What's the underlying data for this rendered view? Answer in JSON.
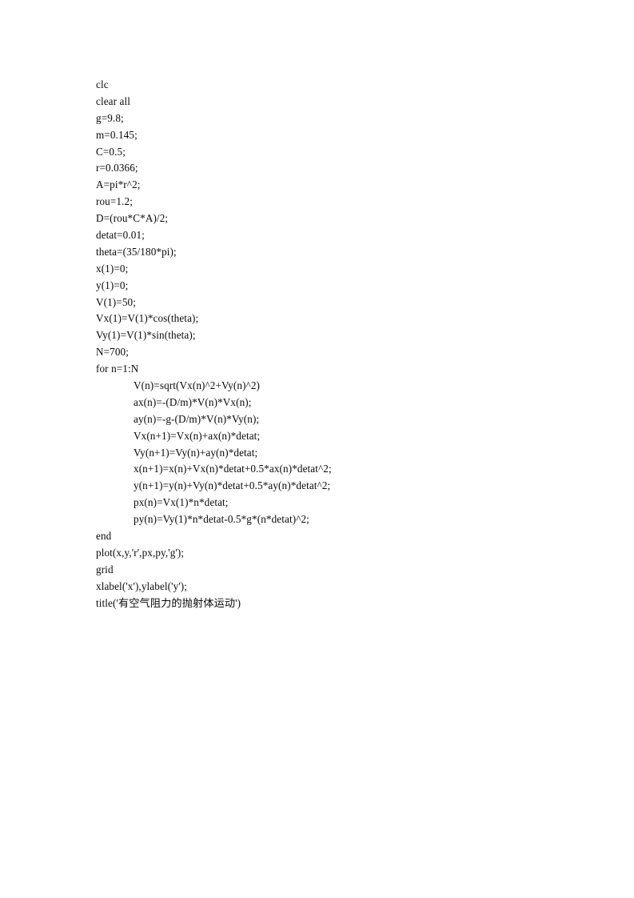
{
  "document": {
    "page_background": "#ffffff",
    "text_color": "#0a0a0a",
    "code": {
      "language": "MATLAB",
      "lines": [
        {
          "text": "clc",
          "indent": false
        },
        {
          "text": "clear all",
          "indent": false
        },
        {
          "text": "g=9.8;",
          "indent": false
        },
        {
          "text": "m=0.145;",
          "indent": false
        },
        {
          "text": "C=0.5;",
          "indent": false
        },
        {
          "text": "r=0.0366;",
          "indent": false
        },
        {
          "text": "A=pi*r^2;",
          "indent": false
        },
        {
          "text": "rou=1.2;",
          "indent": false
        },
        {
          "text": "D=(rou*C*A)/2;",
          "indent": false
        },
        {
          "text": "detat=0.01;",
          "indent": false
        },
        {
          "text": "theta=(35/180*pi);",
          "indent": false
        },
        {
          "text": "x(1)=0;",
          "indent": false
        },
        {
          "text": "y(1)=0;",
          "indent": false
        },
        {
          "text": "V(1)=50;",
          "indent": false
        },
        {
          "text": "Vx(1)=V(1)*cos(theta);",
          "indent": false
        },
        {
          "text": "Vy(1)=V(1)*sin(theta);",
          "indent": false
        },
        {
          "text": "N=700;",
          "indent": false
        },
        {
          "text": "for n=1:N",
          "indent": false
        },
        {
          "text": "V(n)=sqrt(Vx(n)^2+Vy(n)^2)",
          "indent": true
        },
        {
          "text": "ax(n)=-(D/m)*V(n)*Vx(n);",
          "indent": true
        },
        {
          "text": "ay(n)=-g-(D/m)*V(n)*Vy(n);",
          "indent": true
        },
        {
          "text": "Vx(n+1)=Vx(n)+ax(n)*detat;",
          "indent": true
        },
        {
          "text": "Vy(n+1)=Vy(n)+ay(n)*detat;",
          "indent": true
        },
        {
          "text": "x(n+1)=x(n)+Vx(n)*detat+0.5*ax(n)*detat^2;",
          "indent": true
        },
        {
          "text": "y(n+1)=y(n)+Vy(n)*detat+0.5*ay(n)*detat^2;",
          "indent": true
        },
        {
          "text": "px(n)=Vx(1)*n*detat;",
          "indent": true
        },
        {
          "text": "py(n)=Vy(1)*n*detat-0.5*g*(n*detat)^2;",
          "indent": true
        },
        {
          "text": "end",
          "indent": false
        },
        {
          "text": "plot(x,y,'r',px,py,'g');",
          "indent": false
        },
        {
          "text": "grid",
          "indent": false
        },
        {
          "text": "xlabel('x'),ylabel('y');",
          "indent": false
        },
        {
          "text": "title('有空气阻力的抛射体运动')",
          "indent": false
        }
      ]
    }
  }
}
